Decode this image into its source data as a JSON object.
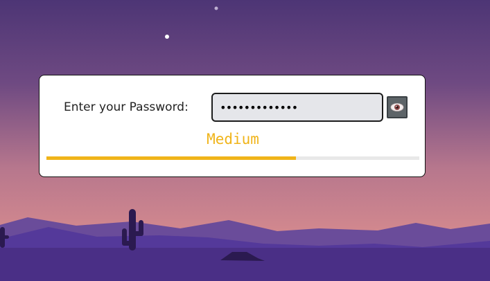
{
  "form": {
    "label": "Enter your Password:",
    "password_value": "•••••••••••••",
    "strength_label": "Medium",
    "strength_fraction": 0.67
  },
  "icons": {
    "reveal": "eye-icon"
  },
  "colors": {
    "strength_medium": "#f0b419",
    "track": "#e8e8e8",
    "card_bg": "#ffffff",
    "sky_top": "#4d3575",
    "sky_bottom": "#d58a8e",
    "ground": "#4a2f86"
  }
}
